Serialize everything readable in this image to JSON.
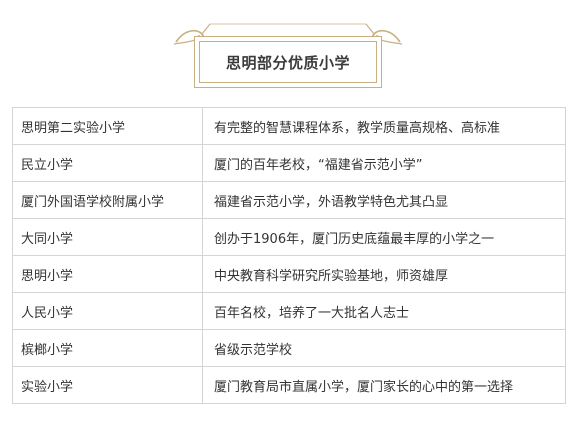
{
  "title": "思明部分优质小学",
  "colors": {
    "accent_gold": "#c9b083",
    "border_gray": "#d4d4d4",
    "text": "#333333"
  },
  "schools": [
    {
      "name": "思明第二实验小学",
      "description": "有完整的智慧课程体系，教学质量高规格、高标准"
    },
    {
      "name": "民立小学",
      "description": "厦门的百年老校，“福建省示范小学”"
    },
    {
      "name": "厦门外国语学校附属小学",
      "description": "福建省示范小学，外语教学特色尤其凸显"
    },
    {
      "name": "大同小学",
      "description": "创办于1906年，厦门历史底蕴最丰厚的小学之一"
    },
    {
      "name": "思明小学",
      "description": "中央教育科学研究所实验基地，师资雄厚"
    },
    {
      "name": "人民小学",
      "description": "百年名校，培养了一大批名人志士"
    },
    {
      "name": "槟榔小学",
      "description": "省级示范学校"
    },
    {
      "name": "实验小学",
      "description": "厦门教育局市直属小学，厦门家长的心中的第一选择"
    }
  ]
}
